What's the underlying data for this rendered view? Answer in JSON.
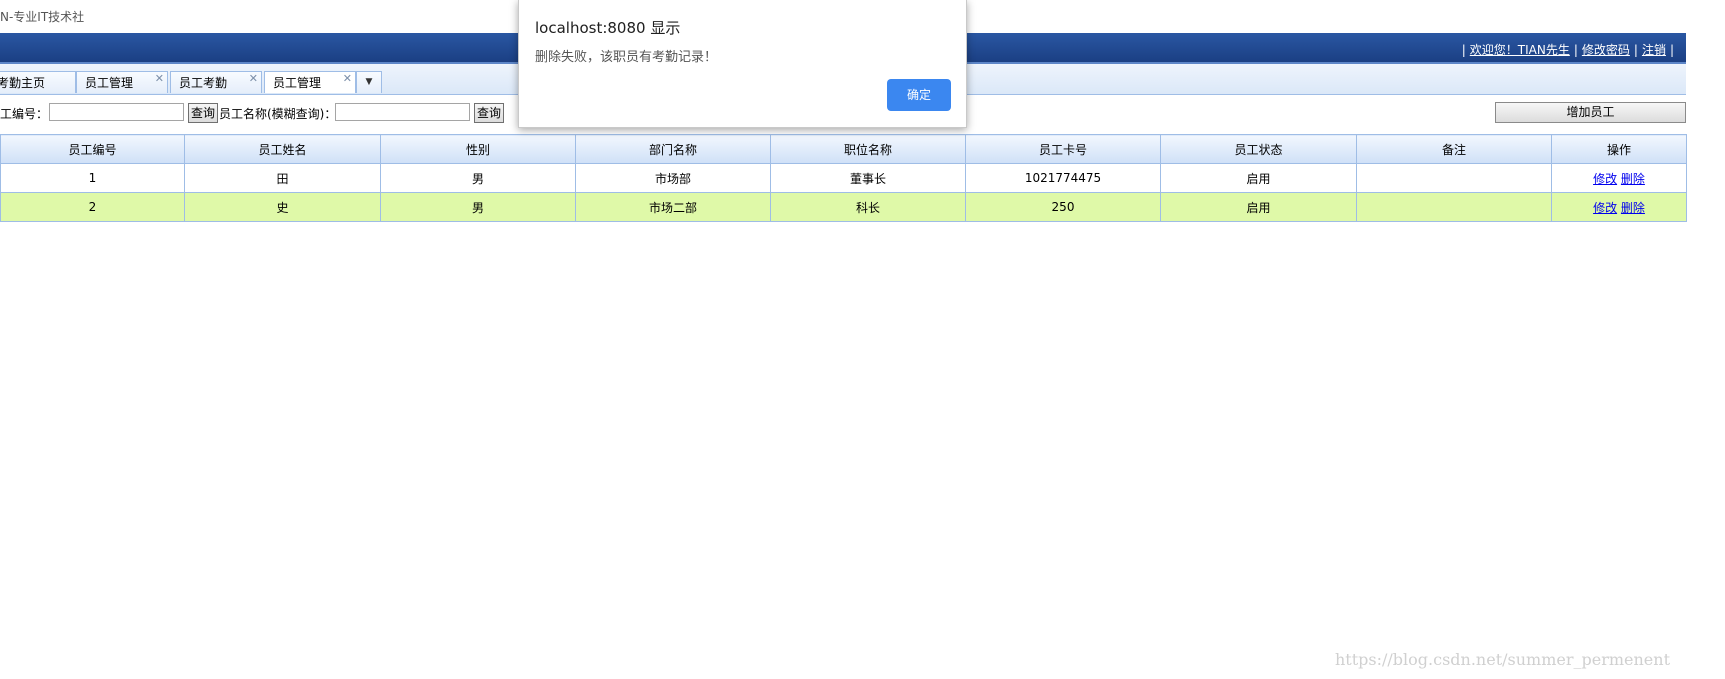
{
  "page": {
    "title": "N-专业IT技术社"
  },
  "header": {
    "separator": "|",
    "welcome": "欢迎您！TIAN先生",
    "change_password": "修改密码",
    "logout": "注销"
  },
  "tabs": [
    {
      "label": "考勤主页",
      "closable": false
    },
    {
      "label": "员工管理",
      "closable": true
    },
    {
      "label": "员工考勤",
      "closable": true
    },
    {
      "label": "员工管理",
      "closable": true,
      "active": true
    }
  ],
  "tab_dropdown": "▼",
  "tab_close_glyph": "✕",
  "search": {
    "id_label": "工编号：",
    "id_value": "",
    "query_button": "查询",
    "name_label": "员工名称(模糊查询)：",
    "name_value": "",
    "query_button_2": "查询",
    "add_button": "增加员工"
  },
  "table": {
    "headers": [
      "员工编号",
      "员工姓名",
      "性别",
      "部门名称",
      "职位名称",
      "员工卡号",
      "员工状态",
      "备注",
      "操作"
    ],
    "rows": [
      {
        "id": "1",
        "name": "田",
        "gender": "男",
        "dept": "市场部",
        "position": "董事长",
        "card": "1021774475",
        "status": "启用",
        "remark": "",
        "edit": "修改",
        "delete": "删除"
      },
      {
        "id": "2",
        "name": "史",
        "gender": "男",
        "dept": "市场二部",
        "position": "科长",
        "card": "250",
        "status": "启用",
        "remark": "",
        "edit": "修改",
        "delete": "删除"
      }
    ]
  },
  "dialog": {
    "title": "localhost:8080 显示",
    "message": "删除失败，该职员有考勤记录！",
    "ok_button": "确定"
  },
  "watermark": "https://blog.csdn.net/summer_permenent",
  "colors": {
    "header_blue": "#1b3f83",
    "alt_row": "#dff9a8",
    "dialog_button": "#3b87f0",
    "link": "#0000ee"
  }
}
